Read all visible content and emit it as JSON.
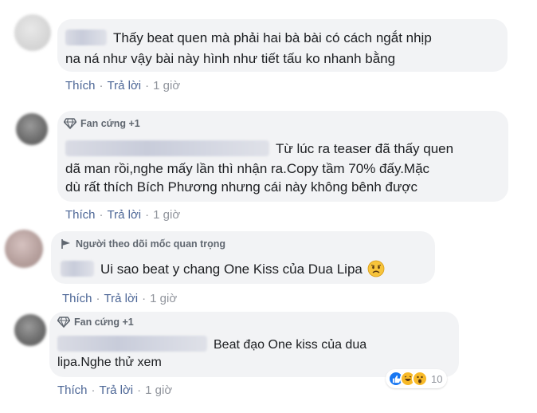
{
  "comments": [
    {
      "badge": "",
      "text_lines": [
        "Thấy beat quen mà phải hai bà bài có cách ngắt nhịp",
        "na ná như vậy bài này hình như tiết tấu ko nhanh bằng"
      ],
      "actions": {
        "like": "Thích",
        "reply": "Trả lời",
        "time": "1 giờ"
      }
    },
    {
      "badge": "Fan cứng +1",
      "badge_icon": "diamond-icon",
      "text_lines": [
        "Từ lúc ra teaser đã thấy quen",
        "dã man rồi,nghe mấy lần thì nhận ra.Copy tầm 70% đấy.Mặc",
        "dù rất thích Bích Phương nhưng cái này không bênh được"
      ],
      "actions": {
        "like": "Thích",
        "reply": "Trả lời",
        "time": "1 giờ"
      }
    },
    {
      "badge": "Người theo dõi mốc quan trọng",
      "badge_icon": "flag-icon",
      "text_lines": [
        "Ui sao beat y chang One Kiss của Dua Lipa"
      ],
      "emoji": "worried-face-icon",
      "actions": {
        "like": "Thích",
        "reply": "Trả lời",
        "time": "1 giờ"
      }
    },
    {
      "badge": "Fan cứng +1",
      "badge_icon": "diamond-icon",
      "text_lines": [
        "Beat đạo One kiss của dua",
        "lipa.Nghe thử xem"
      ],
      "actions": {
        "like": "Thích",
        "reply": "Trả lời",
        "time": "1 giờ"
      },
      "reactions": {
        "icons": [
          "like-icon",
          "haha-icon",
          "wow-icon"
        ],
        "count": "10"
      }
    }
  ],
  "separator": "·",
  "colors": {
    "link": "#4c6696",
    "bubble": "#f2f3f5",
    "meta": "#90949c",
    "like": "#1877f2",
    "haha": "#f7b928"
  }
}
